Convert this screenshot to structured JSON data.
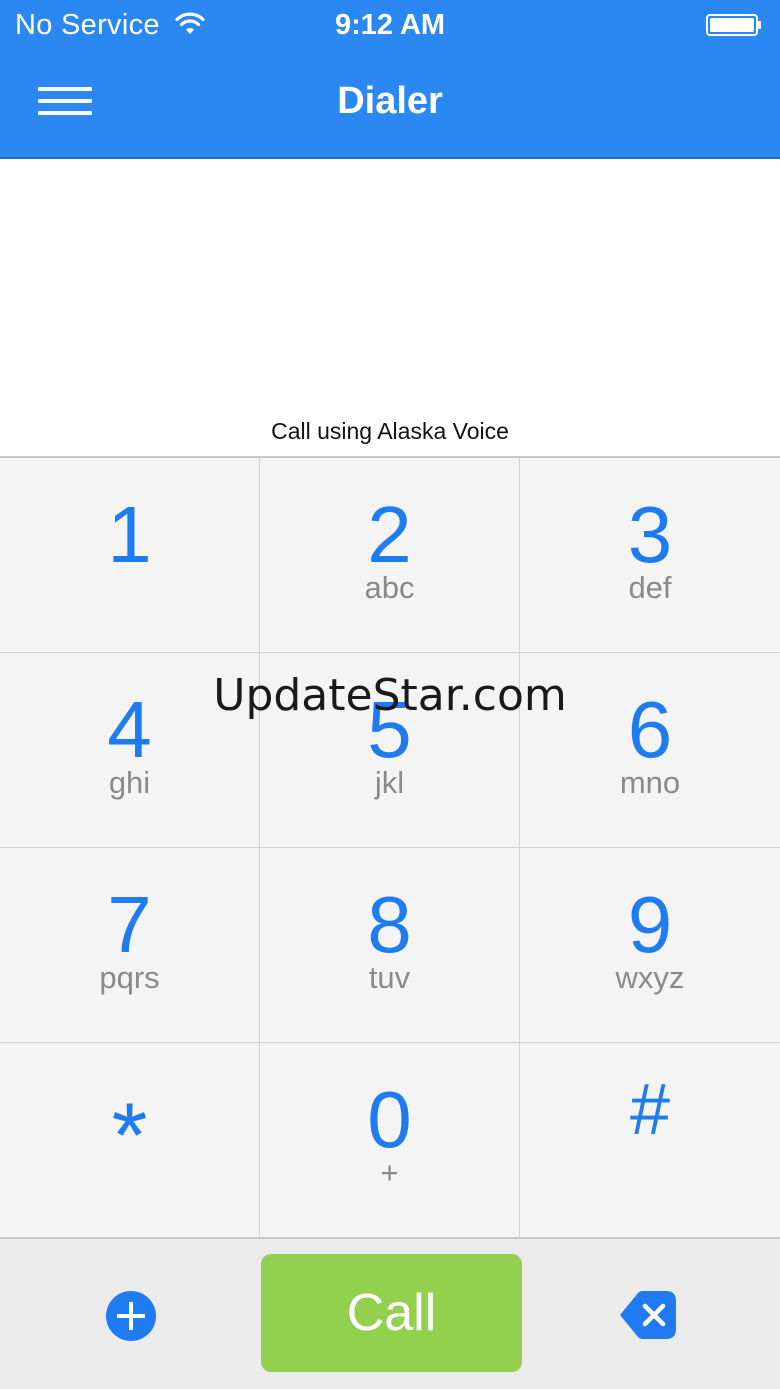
{
  "status_bar": {
    "carrier": "No Service",
    "time": "9:12 AM"
  },
  "nav": {
    "title": "Dialer"
  },
  "display": {
    "call_using": "Call using Alaska Voice"
  },
  "keypad": {
    "keys": [
      {
        "digit": "1",
        "letters": ""
      },
      {
        "digit": "2",
        "letters": "abc"
      },
      {
        "digit": "3",
        "letters": "def"
      },
      {
        "digit": "4",
        "letters": "ghi"
      },
      {
        "digit": "5",
        "letters": "jkl"
      },
      {
        "digit": "6",
        "letters": "mno"
      },
      {
        "digit": "7",
        "letters": "pqrs"
      },
      {
        "digit": "8",
        "letters": "tuv"
      },
      {
        "digit": "9",
        "letters": "wxyz"
      },
      {
        "digit": "*",
        "letters": ""
      },
      {
        "digit": "0",
        "letters": "+"
      },
      {
        "digit": "#",
        "letters": ""
      }
    ]
  },
  "bottom_bar": {
    "call_label": "Call",
    "add_icon": "plus-circle",
    "delete_icon": "backspace-x"
  },
  "watermark": "UpdateStar.com",
  "colors": {
    "header": "#2b87f2",
    "digit": "#1e7cf0",
    "letters": "#8a8a8a",
    "call_button": "#93d04e",
    "keypad_bg": "#f4f4f4"
  }
}
